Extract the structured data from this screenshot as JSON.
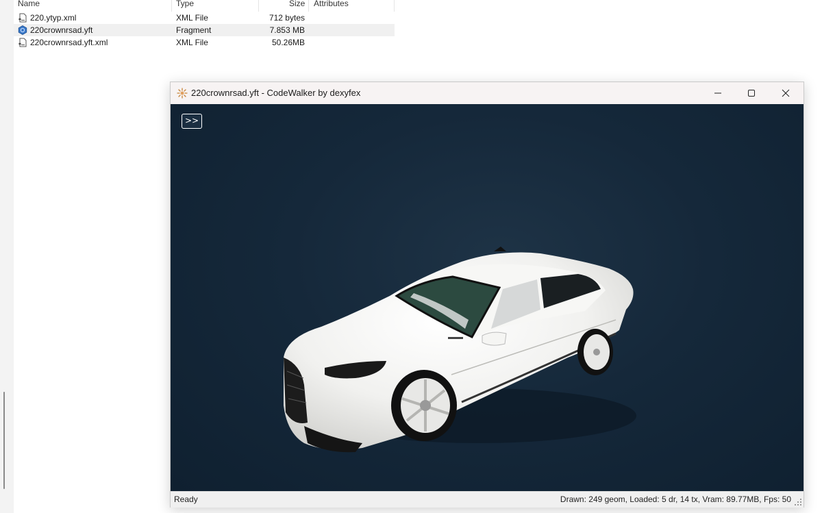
{
  "explorer": {
    "columns": {
      "name": "Name",
      "type": "Type",
      "size": "Size",
      "attributes": "Attributes"
    },
    "files": [
      {
        "name": "220.ytyp.xml",
        "type": "XML File",
        "size": "712 bytes",
        "icon": "xml-file-icon",
        "selected": false
      },
      {
        "name": "220crownrsad.yft",
        "type": "Fragment",
        "size": "7.853 MB",
        "icon": "codewalker-file-icon",
        "selected": true
      },
      {
        "name": "220crownrsad.yft.xml",
        "type": "XML File",
        "size": "50.26MB",
        "icon": "xml-file-icon",
        "selected": false
      }
    ]
  },
  "window": {
    "title": "220crownrsad.yft - CodeWalker by dexyfex",
    "toggle_label": ">>",
    "status_left": "Ready",
    "status_right": "Drawn: 249 geom, Loaded: 5 dr, 14 tx, Vram: 89.77MB, Fps: 50"
  },
  "colors": {
    "viewport_bg": "#12243a",
    "selected_row": "#f0f0f0",
    "accent_icon": "#3a78c8"
  }
}
